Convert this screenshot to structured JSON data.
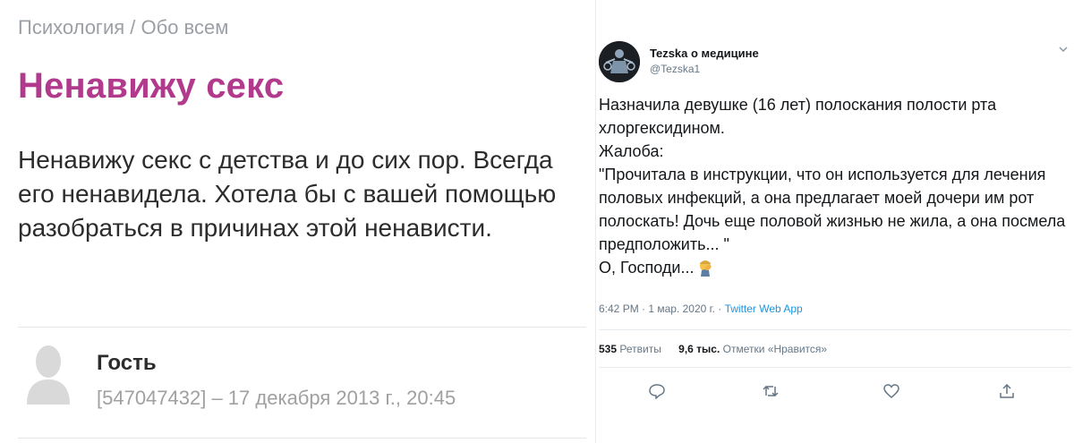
{
  "forum": {
    "breadcrumb": {
      "section": "Психология",
      "separator": " / ",
      "subsection": "Обо всем"
    },
    "title": "Ненавижу секс",
    "body": "Ненавижу секс с детства и до сих пор. Всегда его ненавидела. Хотела бы с вашей помощью разобраться в причинах этой ненависти.",
    "post": {
      "author": "Гость",
      "meta": "[547047432] – 17 декабря 2013 г., 20:45"
    },
    "colors": {
      "title": "#b23a8c",
      "meta": "#a0a0a0"
    }
  },
  "tweet": {
    "display_name": "Tezska о медицине",
    "handle": "@Tezska1",
    "text": "Назначила девушке (16 лет) полоскания полости рта хлоргексидином.\nЖалоба:\n\"Прочитала в инструкции, что он используется для лечения половых инфекций, а она предлагает моей дочери им рот полоскать! Дочь еще половой жизнью не жила, а она посмела предположить... \"\nО, Господи...",
    "emoji": "facepalm-emoji",
    "timestamp": "6:42 PM · 1 мар. 2020 г. · ",
    "app": "Twitter Web App",
    "retweets_count": "535",
    "retweets_label": " Ретвиты",
    "likes_count": "9,6 тыс.",
    "likes_label": " Отметки «Нравится»",
    "icons": [
      "reply-icon",
      "retweet-icon",
      "like-icon",
      "share-icon"
    ],
    "colors": {
      "link": "#1b95e0",
      "secondary": "#657786"
    }
  }
}
